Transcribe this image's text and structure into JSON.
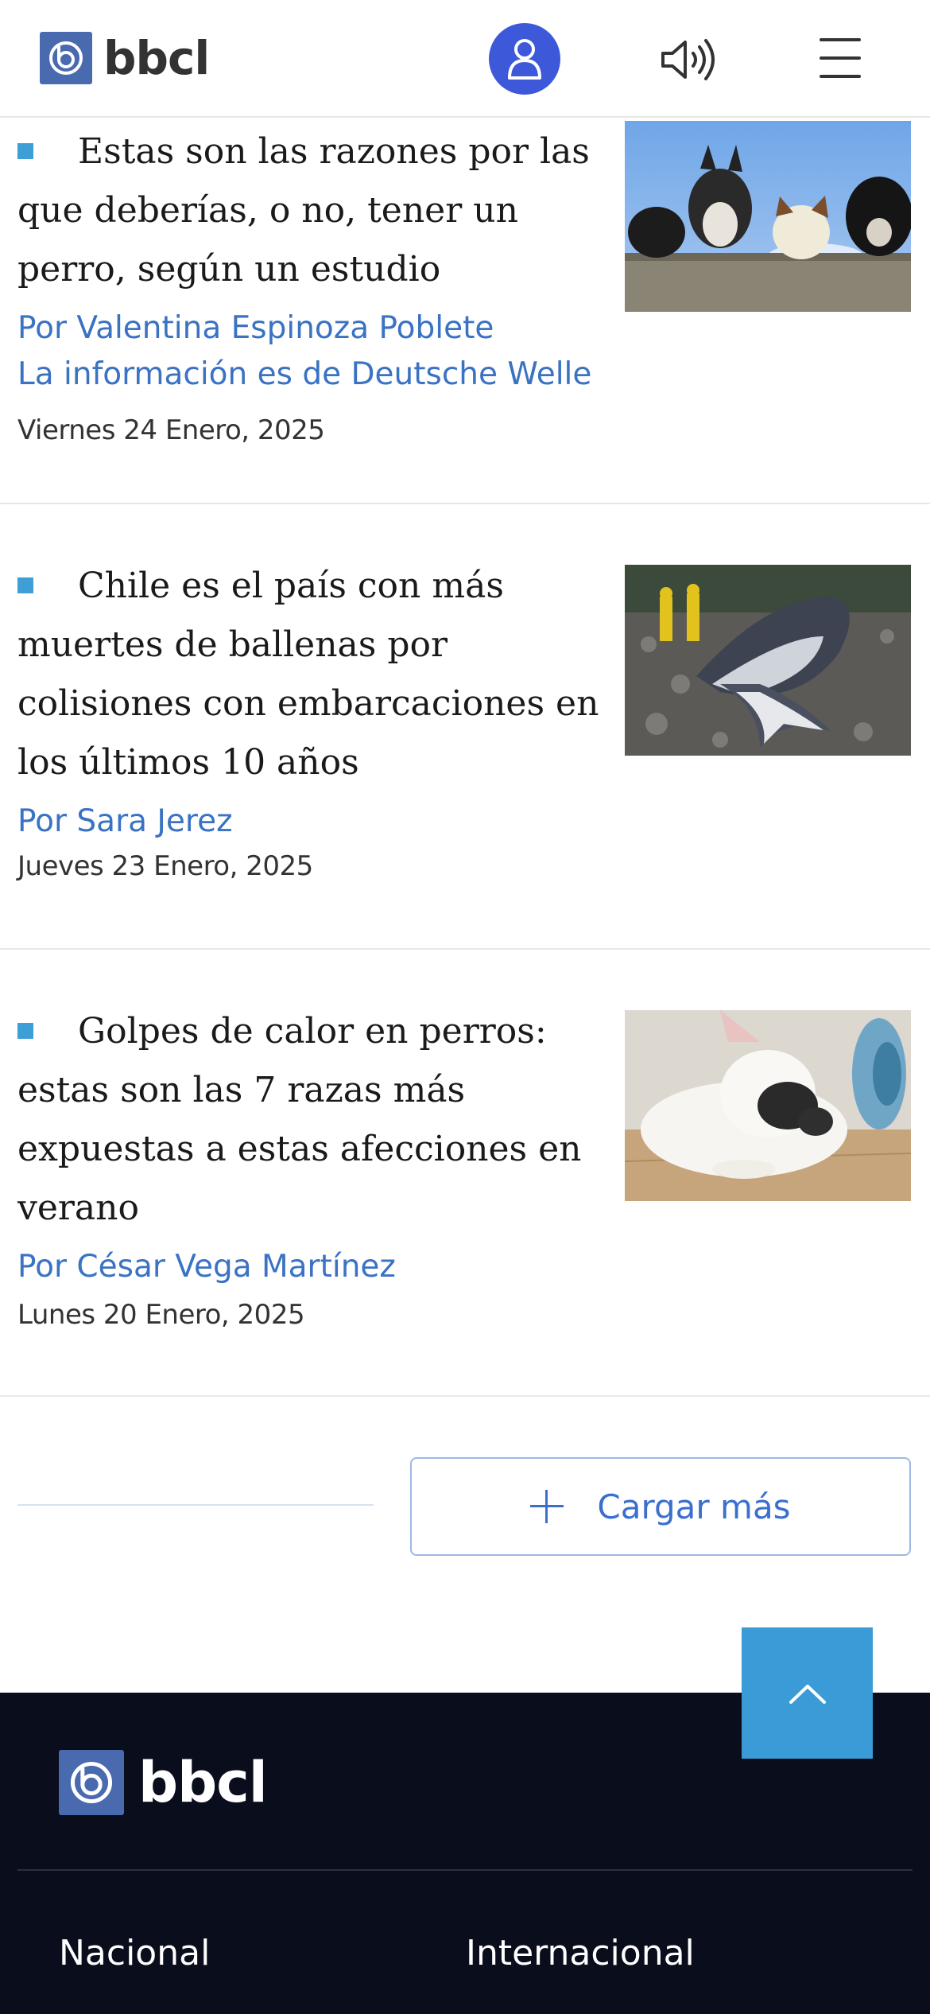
{
  "header": {
    "logo_text": "bbcl",
    "user_icon": "user-icon",
    "audio_icon": "speaker-icon",
    "menu_icon": "hamburger-menu-icon"
  },
  "articles": [
    {
      "headline": "Estas son las razones por las que deberías, o no, tener un perro, según un estudio",
      "byline": "Por Valentina Espinoza Poblete",
      "byline2": "La información es de Deutsche Welle",
      "date": "Viernes 24 Enero, 2025",
      "image": "dogs-looking-over-wall"
    },
    {
      "headline": "Chile es el país con más muertes de ballenas por colisiones con embarcaciones en los últimos 10 años",
      "byline": "Por Sara Jerez",
      "date": "Jueves 23 Enero, 2025",
      "image": "stranded-whale-on-beach"
    },
    {
      "headline": "Golpes de calor en perros: estas son las 7 razas más expuestas a estas afecciones en verano",
      "byline": "Por César Vega Martínez",
      "date": "Lunes 20 Enero, 2025",
      "image": "french-bulldog-sleeping-by-fan"
    }
  ],
  "load_more": {
    "label": "Cargar más",
    "icon": "plus-icon"
  },
  "back_to_top": {
    "icon": "chevron-up-icon"
  },
  "footer": {
    "logo_text": "bbcl",
    "links": [
      "Nacional",
      "Internacional"
    ]
  },
  "colors": {
    "accent": "#3e9ed6",
    "link": "#3a72c4",
    "user_button": "#3d59d9",
    "logo": "#4a6ab0",
    "footer_bg": "#0a0d1c"
  }
}
